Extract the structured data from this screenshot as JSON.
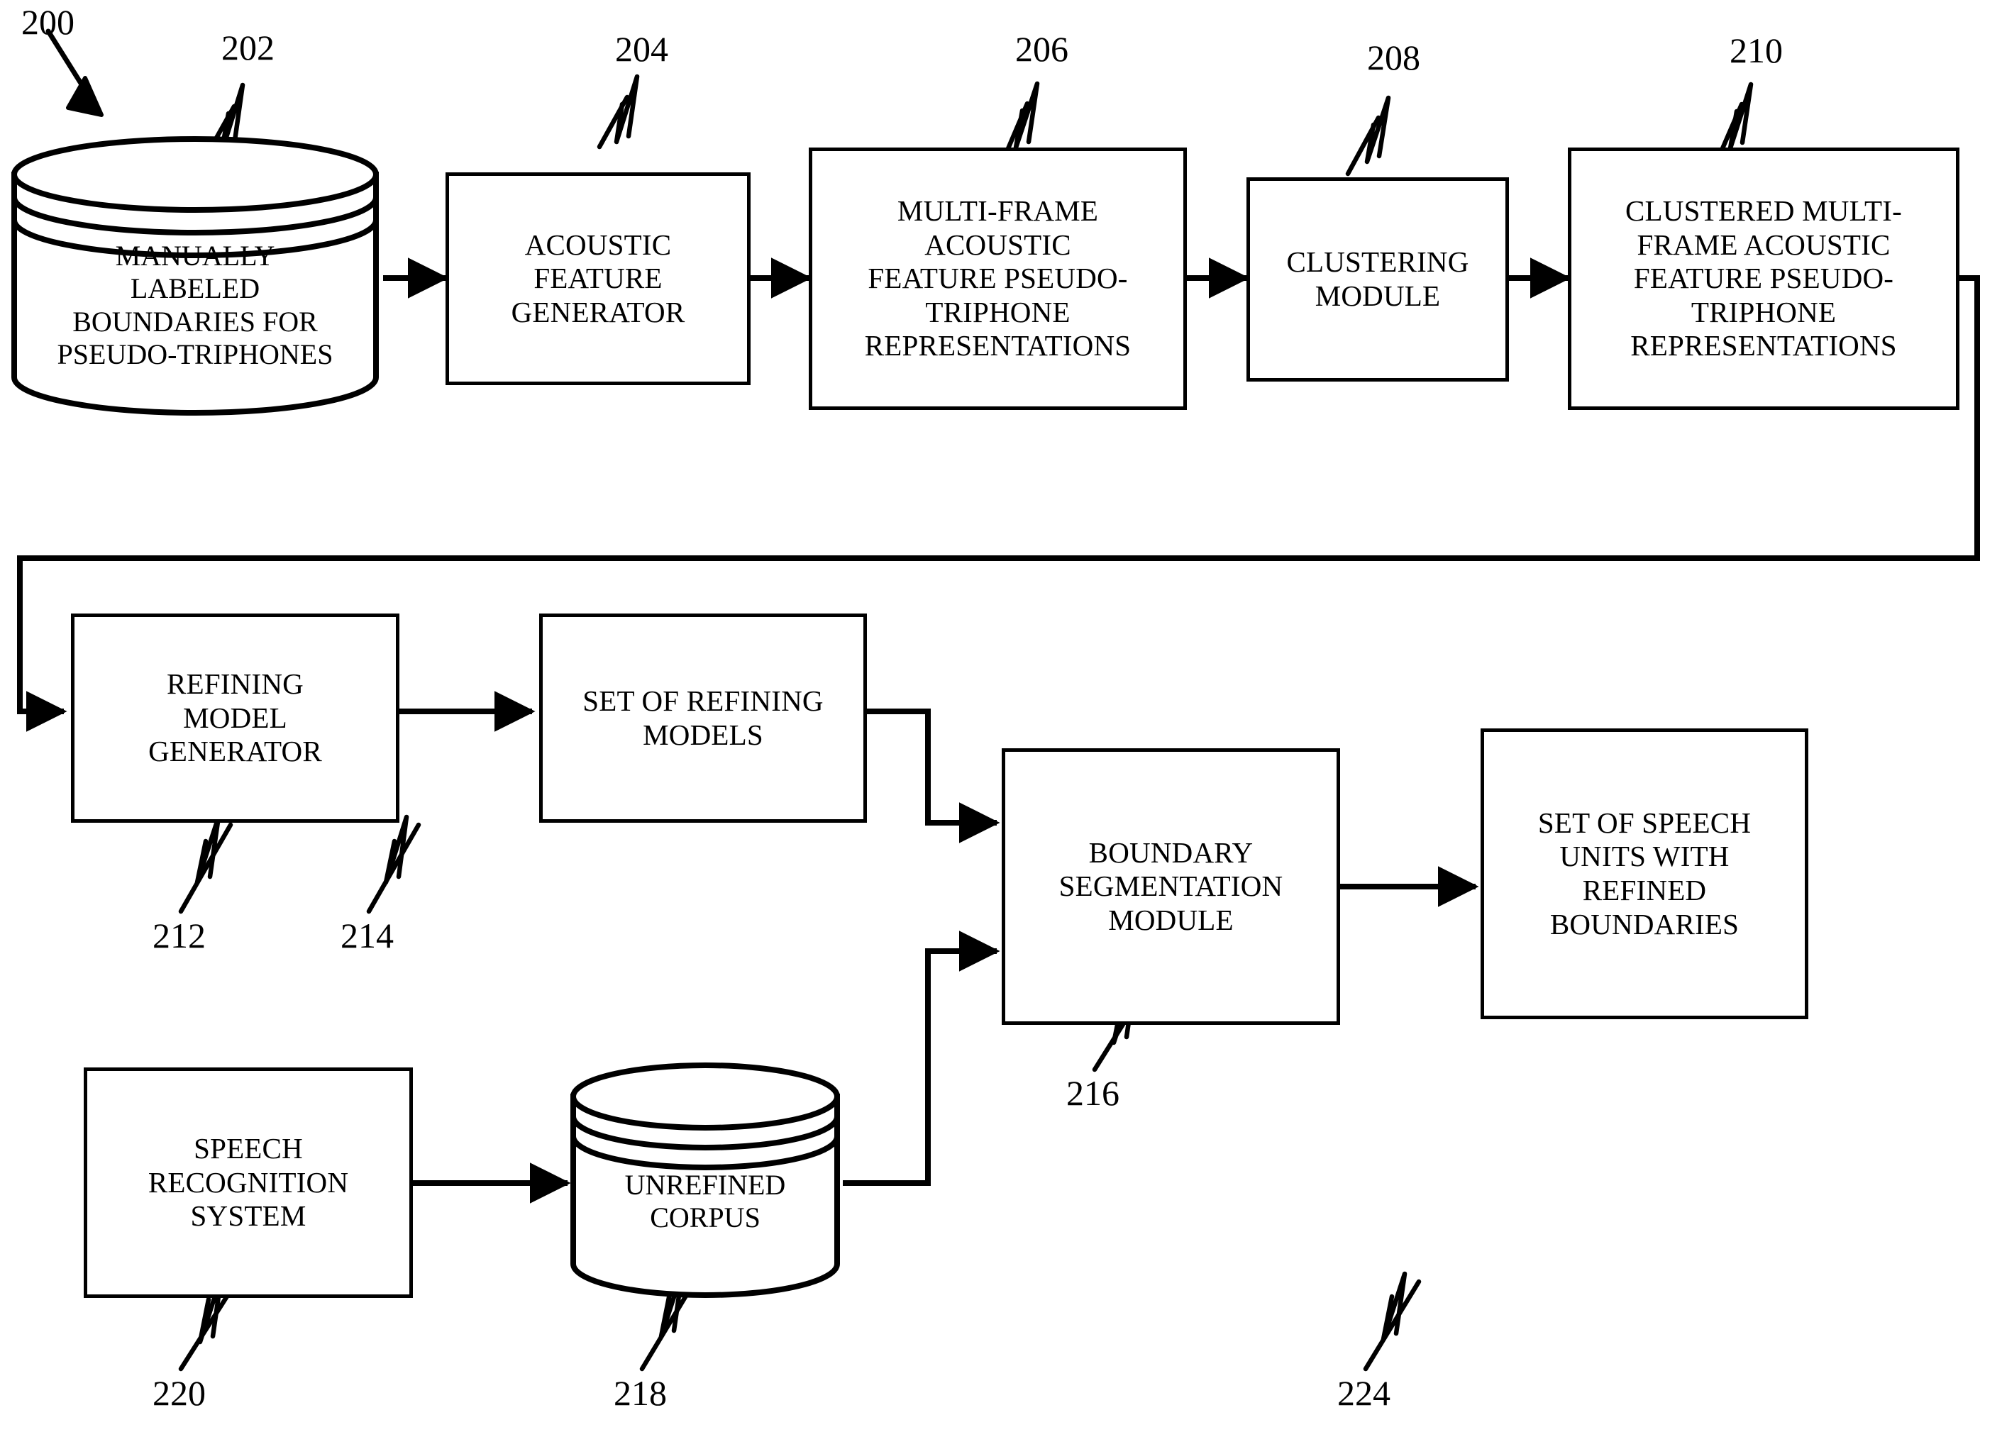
{
  "figure": {
    "type": "patent-flow-diagram",
    "overall_reference": "200"
  },
  "nodes": [
    {
      "id": "202",
      "shape": "cylinder",
      "label": "MANUALLY\nLABELED\nBOUNDARIES FOR\nPSEUDO-TRIPHONES",
      "ref": "202"
    },
    {
      "id": "204",
      "shape": "rect",
      "label": "ACOUSTIC\nFEATURE\nGENERATOR",
      "ref": "204"
    },
    {
      "id": "206",
      "shape": "rect",
      "label": "MULTI-FRAME\nACOUSTIC\nFEATURE PSEUDO-\nTRIPHONE\nREPRESENTATIONS",
      "ref": "206"
    },
    {
      "id": "208",
      "shape": "rect",
      "label": "CLUSTERING\nMODULE",
      "ref": "208"
    },
    {
      "id": "210",
      "shape": "rect",
      "label": "CLUSTERED MULTI-\nFRAME ACOUSTIC\nFEATURE PSEUDO-\nTRIPHONE\nREPRESENTATIONS",
      "ref": "210"
    },
    {
      "id": "212",
      "shape": "rect",
      "label": "REFINING\nMODEL\nGENERATOR",
      "ref": "212"
    },
    {
      "id": "214",
      "shape": "rect",
      "label": "SET OF REFINING\nMODELS",
      "ref": "214"
    },
    {
      "id": "216",
      "shape": "rect",
      "label": "BOUNDARY\nSEGMENTATION\nMODULE",
      "ref": "216"
    },
    {
      "id": "224",
      "shape": "rect",
      "label": "SET OF SPEECH\nUNITS WITH\nREFINED\nBOUNDARIES",
      "ref": "224"
    },
    {
      "id": "220",
      "shape": "rect",
      "label": "SPEECH\nRECOGNITION\nSYSTEM",
      "ref": "220"
    },
    {
      "id": "218",
      "shape": "cylinder",
      "label": "UNREFINED\nCORPUS",
      "ref": "218"
    }
  ],
  "reference_numerals": {
    "overall": "200",
    "n202": "202",
    "n204": "204",
    "n206": "206",
    "n208": "208",
    "n210": "210",
    "n212": "212",
    "n214": "214",
    "n216": "216",
    "n218": "218",
    "n220": "220",
    "n224": "224"
  },
  "colors": {
    "ink": "#000000",
    "paper": "#ffffff"
  }
}
